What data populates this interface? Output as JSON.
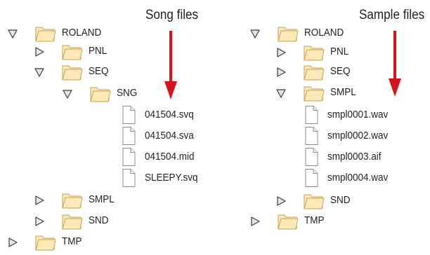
{
  "song_panel": {
    "heading": "Song files",
    "tree": [
      {
        "label": "ROLAND",
        "kind": "folder",
        "state": "expanded"
      },
      {
        "label": "PNL",
        "kind": "folder",
        "state": "collapsed"
      },
      {
        "label": "SEQ",
        "kind": "folder",
        "state": "expanded"
      },
      {
        "label": "SNG",
        "kind": "folder",
        "state": "expanded"
      },
      {
        "label": "041504.svq",
        "kind": "file"
      },
      {
        "label": "041504.sva",
        "kind": "file"
      },
      {
        "label": "041504.mid",
        "kind": "file"
      },
      {
        "label": "SLEEPY.svq",
        "kind": "file"
      },
      {
        "label": "SMPL",
        "kind": "folder",
        "state": "collapsed"
      },
      {
        "label": "SND",
        "kind": "folder",
        "state": "collapsed"
      },
      {
        "label": "TMP",
        "kind": "folder",
        "state": "collapsed"
      }
    ]
  },
  "sample_panel": {
    "heading": "Sample files",
    "tree": [
      {
        "label": "ROLAND",
        "kind": "folder",
        "state": "expanded"
      },
      {
        "label": "PNL",
        "kind": "folder",
        "state": "collapsed"
      },
      {
        "label": "SEQ",
        "kind": "folder",
        "state": "collapsed"
      },
      {
        "label": "SMPL",
        "kind": "folder",
        "state": "expanded"
      },
      {
        "label": "smpl0001.wav",
        "kind": "file"
      },
      {
        "label": "smpl0002.wav",
        "kind": "file"
      },
      {
        "label": "smpl0003.aif",
        "kind": "file"
      },
      {
        "label": "smpl0004.wav",
        "kind": "file"
      },
      {
        "label": "SND",
        "kind": "folder",
        "state": "collapsed"
      },
      {
        "label": "TMP",
        "kind": "folder",
        "state": "collapsed"
      }
    ]
  },
  "colors": {
    "arrow": "#d4151b",
    "folder_fill": "#fde9b8",
    "folder_stroke": "#c8a052",
    "triangle_fill": "#e6e6e6",
    "triangle_stroke": "#3d3d3d",
    "file_stroke": "#8c8c8c",
    "text": "#231f20"
  },
  "icons": {
    "folder": "folder-icon",
    "file": "file-icon",
    "expanded": "triangle-down-icon",
    "collapsed": "triangle-right-icon"
  }
}
